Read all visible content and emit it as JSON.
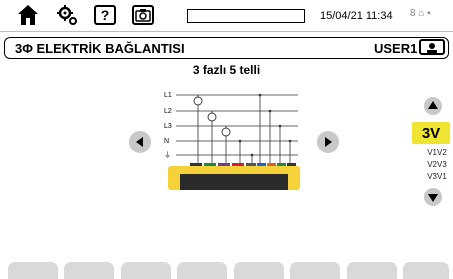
{
  "status_bar": {
    "datetime": "15/04/21 11:34",
    "icons": [
      "home-icon",
      "settings-icon",
      "help-icon",
      "camera-icon",
      "battery-icon"
    ],
    "help_glyph": "?",
    "right_glyphs": "8 ⌂ ▪"
  },
  "title_bar": {
    "title": "3Φ  ELEKTRİK BAĞLANTISI",
    "user": "USER1"
  },
  "connection": {
    "subtitle": "3 fazlı 5 telli",
    "wire_labels": [
      "L1",
      "L2",
      "L3",
      "N",
      "⏚"
    ]
  },
  "selector": {
    "active": "3V",
    "options": [
      "V1V2",
      "V2V3",
      "V3V1"
    ]
  },
  "colors": {
    "accent_yellow": "#f0e432",
    "nav_gray": "#c8c8c8",
    "tab_gray": "#d9d9d9",
    "device_yellow": "#f5d23a"
  },
  "bottom_tabs_count": 8
}
